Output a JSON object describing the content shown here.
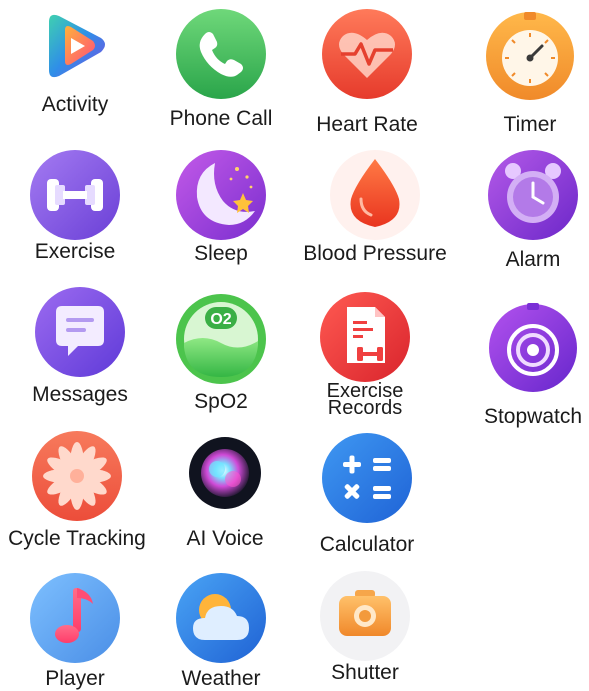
{
  "apps": [
    {
      "label": "Activity",
      "icon": "play-icon"
    },
    {
      "label": "Phone Call",
      "icon": "phone-icon"
    },
    {
      "label": "Heart Rate",
      "icon": "heart-icon"
    },
    {
      "label": "Timer",
      "icon": "timer-icon"
    },
    {
      "label": "Exercise",
      "icon": "dumbbell-icon"
    },
    {
      "label": "Sleep",
      "icon": "moon-icon"
    },
    {
      "label": "Blood Pressure",
      "icon": "blood-drop-icon"
    },
    {
      "label": "Alarm",
      "icon": "alarm-clock-icon"
    },
    {
      "label": "Messages",
      "icon": "message-icon"
    },
    {
      "label": "SpO2",
      "icon": "spo2-icon",
      "badge": "O2"
    },
    {
      "label_line1": "Exercise",
      "label_line2": "Records",
      "icon": "exercise-records-icon"
    },
    {
      "label": "Stopwatch",
      "icon": "stopwatch-icon"
    },
    {
      "label": "Cycle Tracking",
      "icon": "flower-icon"
    },
    {
      "label": "AI Voice",
      "icon": "ai-voice-icon"
    },
    {
      "label": "Calculator",
      "icon": "calculator-icon"
    },
    {
      "label": "Player",
      "icon": "music-note-icon"
    },
    {
      "label": "Weather",
      "icon": "weather-icon"
    },
    {
      "label": "Shutter",
      "icon": "camera-icon"
    }
  ],
  "colors": {
    "activity": "#2fa0e0",
    "phone": "#3cb85a",
    "heart": "#f0553d",
    "timer": "#f5a23a",
    "exercise": "#8a63e6",
    "sleep": "#9b3fd8",
    "blood": "#f24b2a",
    "alarm": "#8f3fd6",
    "messages": "#8b5be6",
    "spo2": "#49c44c",
    "records": "#f03c3c",
    "stopwatch": "#9a3fe0",
    "cycle": "#f4664a",
    "calculator": "#2a7ee6",
    "player": "#5aa6f0",
    "weather": "#2f86e6",
    "shutter": "#f3a146"
  }
}
